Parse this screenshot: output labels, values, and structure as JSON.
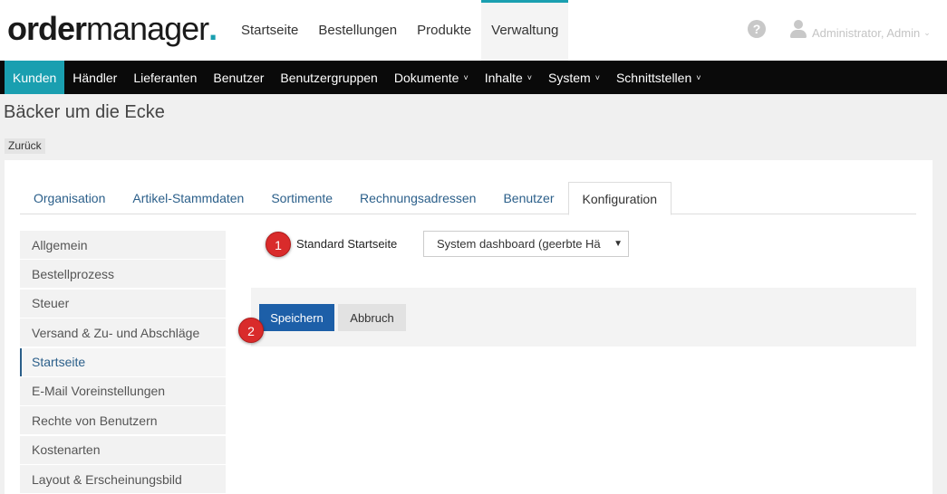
{
  "logo": {
    "bold": "order",
    "light": "manager",
    "dot": "."
  },
  "topnav": [
    "Startseite",
    "Bestellungen",
    "Produkte",
    "Verwaltung"
  ],
  "topnav_active": "Verwaltung",
  "help": {
    "glyph": "?",
    "icon": "help-icon"
  },
  "user": {
    "name": "Administrator, Admin",
    "icon": "user-icon"
  },
  "mainnav": {
    "items": [
      {
        "label": "Kunden",
        "dropdown": false
      },
      {
        "label": "Händler",
        "dropdown": false
      },
      {
        "label": "Lieferanten",
        "dropdown": false
      },
      {
        "label": "Benutzer",
        "dropdown": false
      },
      {
        "label": "Benutzergruppen",
        "dropdown": false
      },
      {
        "label": "Dokumente",
        "dropdown": true
      },
      {
        "label": "Inhalte",
        "dropdown": true
      },
      {
        "label": "System",
        "dropdown": true
      },
      {
        "label": "Schnittstellen",
        "dropdown": true
      }
    ],
    "active": "Kunden"
  },
  "page": {
    "title": "Bäcker um die Ecke",
    "back_label": "Zurück"
  },
  "tabs": [
    "Organisation",
    "Artikel-Stammdaten",
    "Sortimente",
    "Rechnungsadressen",
    "Benutzer",
    "Konfiguration"
  ],
  "tabs_active": "Konfiguration",
  "sidenav": [
    "Allgemein",
    "Bestellprozess",
    "Steuer",
    "Versand & Zu- und Abschläge",
    "Startseite",
    "E-Mail Voreinstellungen",
    "Rechte von Benutzern",
    "Kostenarten",
    "Layout & Erscheinungsbild"
  ],
  "sidenav_active": "Startseite",
  "form": {
    "label": "Standard Startseite",
    "select_value": "System dashboard (geerbte Hä",
    "save_label": "Speichern",
    "cancel_label": "Abbruch"
  },
  "badges": [
    "1",
    "2"
  ],
  "colors": {
    "accent": "#1a9fb0",
    "primary_button": "#1d5fa8",
    "badge": "#d92b2b",
    "link": "#2b5f8a"
  }
}
